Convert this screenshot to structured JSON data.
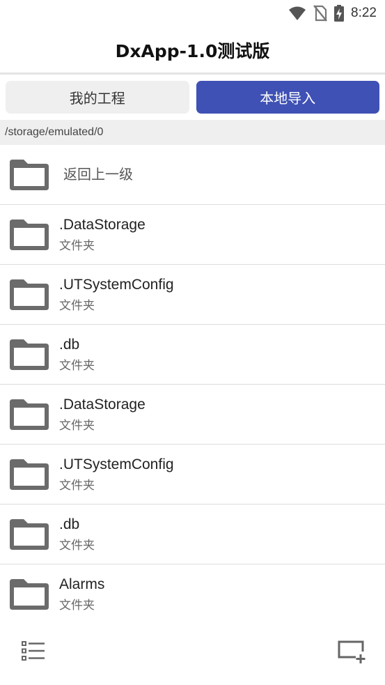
{
  "status_bar": {
    "time": "8:22",
    "icons": [
      "wifi-icon",
      "no-sim-icon",
      "battery-charging-icon"
    ]
  },
  "app": {
    "title": "DxApp-1.0测试版"
  },
  "tabs": [
    {
      "label": "我的工程",
      "active": false
    },
    {
      "label": "本地导入",
      "active": true
    }
  ],
  "path": "/storage/emulated/0",
  "back_row": {
    "label": "返回上一级",
    "icon": "folder-icon"
  },
  "files": [
    {
      "name": ".DataStorage",
      "type": "文件夹",
      "icon": "folder-icon"
    },
    {
      "name": ".UTSystemConfig",
      "type": "文件夹",
      "icon": "folder-icon"
    },
    {
      "name": ".db",
      "type": "文件夹",
      "icon": "folder-icon"
    },
    {
      "name": ".DataStorage",
      "type": "文件夹",
      "icon": "folder-icon"
    },
    {
      "name": ".UTSystemConfig",
      "type": "文件夹",
      "icon": "folder-icon"
    },
    {
      "name": ".db",
      "type": "文件夹",
      "icon": "folder-icon"
    },
    {
      "name": "Alarms",
      "type": "文件夹",
      "icon": "folder-icon"
    }
  ],
  "bottom_bar": {
    "left_icon": "list-view-icon",
    "right_icon": "new-folder-icon"
  },
  "colors": {
    "accent": "#3f51b5",
    "tab_inactive": "#efefef",
    "path_bg": "#efefef",
    "folder": "#6b6b6b"
  }
}
